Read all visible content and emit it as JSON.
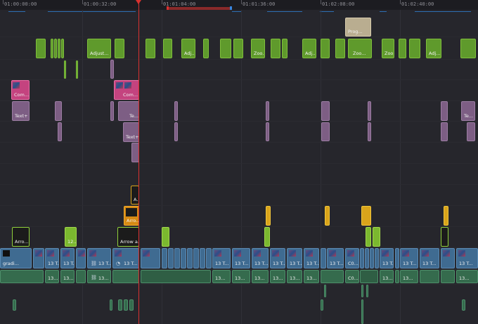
{
  "ruler": {
    "timecodes": [
      "01:00:00:00",
      "01:00:32:00",
      "01:01:04:00",
      "01:01:36:00",
      "01:02:08:00",
      "01:02:40:00"
    ]
  },
  "colors": {
    "playhead": "#d8312f",
    "adjustment_clip": "#7bb82f",
    "fusion_title": "#c4437f",
    "text_plus": "#7d5e84",
    "generator": "#b9ad90",
    "video_clip": "#3f6b91",
    "audio_clip": "#356b4d",
    "effect_clip": "#d9a41b"
  },
  "clips": {
    "prog": "Prog...",
    "adjust_1": "Adjust...",
    "adj_a": "Adj...",
    "zoo_1": "Zoo...",
    "adj_b": "Adj...",
    "zoo_2": "Zoo...",
    "zoo_3": "Zoo...",
    "adj_c": "Adj...",
    "com_1": "Com...",
    "com_2": "Com...",
    "text_1": "Text+",
    "te_1": "Te...",
    "te_2": "Te...",
    "text_2": "Text+",
    "a_small": "A...",
    "arro_1": "Arro...",
    "arro_2": "Arro...",
    "n12": "12...",
    "arrow_a": "Arrow a...",
    "gradi_v": "gradi...",
    "v13_a": "13 T...",
    "v13_b": "13 T...",
    "v13_c": "13 T...",
    "v13_d": "13 T...",
    "v13_e": "13 T...",
    "v13_f": "13 T...",
    "v13_g": "13 T...",
    "v13_h": "13 T...",
    "v13_i": "13 T...",
    "v13_j": "13 T...",
    "v13_k": "13 T...",
    "v13_l": "13 T...",
    "v13_m": "13 T...",
    "v13_n": "13 T...",
    "c0_v": "C0...",
    "v13_o": "13 T...",
    "a13_a": "13...",
    "a13_b": "13...",
    "a13_c": "13...",
    "a13_d": "13...",
    "a13_e": "13...",
    "a13_f": "13...",
    "a13_g": "13...",
    "a13_h": "13...",
    "a13_i": "13...",
    "c0_a": "C0...",
    "a13_j": "13...",
    "a13_k": "13...",
    "a13_l": "13..."
  }
}
